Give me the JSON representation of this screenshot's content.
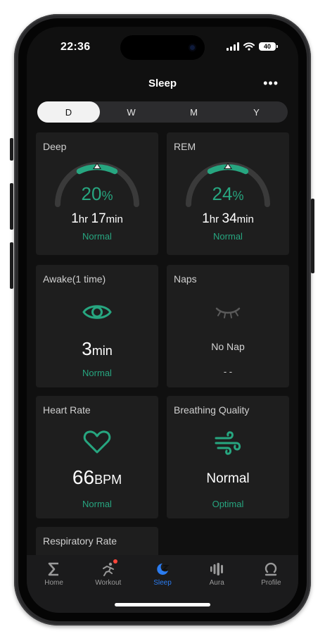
{
  "status_bar": {
    "time": "22:36",
    "battery": "40"
  },
  "header": {
    "title": "Sleep",
    "more_label": "•••"
  },
  "period_tabs": [
    "D",
    "W",
    "M",
    "Y"
  ],
  "active_period": "D",
  "cards": {
    "deep": {
      "title": "Deep",
      "percent": "20",
      "percent_unit": "%",
      "hr": "1",
      "hr_unit": "hr",
      "min": "17",
      "min_unit": "min",
      "status": "Normal",
      "fraction": 0.2
    },
    "rem": {
      "title": "REM",
      "percent": "24",
      "percent_unit": "%",
      "hr": "1",
      "hr_unit": "hr",
      "min": "34",
      "min_unit": "min",
      "status": "Normal",
      "fraction": 0.24
    },
    "awake": {
      "title": "Awake(1 time)",
      "value": "3",
      "unit": "min",
      "status": "Normal"
    },
    "naps": {
      "title": "Naps",
      "value": "No Nap",
      "status": "- -"
    },
    "heart_rate": {
      "title": "Heart Rate",
      "value": "66",
      "unit": "BPM",
      "status": "Normal"
    },
    "breathing": {
      "title": "Breathing Quality",
      "value": "Normal",
      "status": "Optimal"
    },
    "respiratory": {
      "title": "Respiratory Rate"
    }
  },
  "tab_bar": [
    {
      "label": "Home",
      "icon": "sigma-icon"
    },
    {
      "label": "Workout",
      "icon": "running-icon"
    },
    {
      "label": "Sleep",
      "icon": "moon-icon"
    },
    {
      "label": "Aura",
      "icon": "aura-icon"
    },
    {
      "label": "Profile",
      "icon": "profile-icon"
    }
  ],
  "colors": {
    "accent": "#27a680",
    "active_tab": "#2b7cf0",
    "card": "#1e1e1e",
    "background": "#101010"
  }
}
